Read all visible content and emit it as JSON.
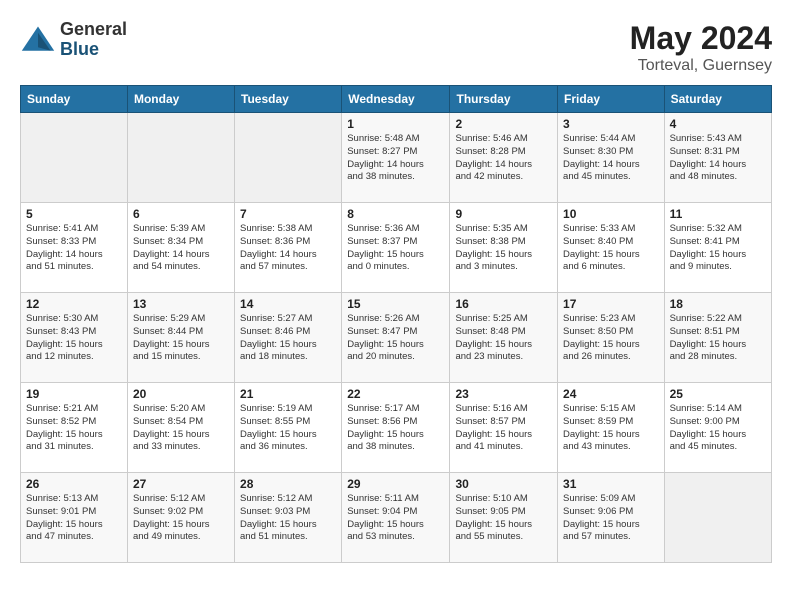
{
  "header": {
    "logo_general": "General",
    "logo_blue": "Blue",
    "month_year": "May 2024",
    "location": "Torteval, Guernsey"
  },
  "days_of_week": [
    "Sunday",
    "Monday",
    "Tuesday",
    "Wednesday",
    "Thursday",
    "Friday",
    "Saturday"
  ],
  "weeks": [
    [
      {
        "day": "",
        "info": ""
      },
      {
        "day": "",
        "info": ""
      },
      {
        "day": "",
        "info": ""
      },
      {
        "day": "1",
        "info": "Sunrise: 5:48 AM\nSunset: 8:27 PM\nDaylight: 14 hours\nand 38 minutes."
      },
      {
        "day": "2",
        "info": "Sunrise: 5:46 AM\nSunset: 8:28 PM\nDaylight: 14 hours\nand 42 minutes."
      },
      {
        "day": "3",
        "info": "Sunrise: 5:44 AM\nSunset: 8:30 PM\nDaylight: 14 hours\nand 45 minutes."
      },
      {
        "day": "4",
        "info": "Sunrise: 5:43 AM\nSunset: 8:31 PM\nDaylight: 14 hours\nand 48 minutes."
      }
    ],
    [
      {
        "day": "5",
        "info": "Sunrise: 5:41 AM\nSunset: 8:33 PM\nDaylight: 14 hours\nand 51 minutes."
      },
      {
        "day": "6",
        "info": "Sunrise: 5:39 AM\nSunset: 8:34 PM\nDaylight: 14 hours\nand 54 minutes."
      },
      {
        "day": "7",
        "info": "Sunrise: 5:38 AM\nSunset: 8:36 PM\nDaylight: 14 hours\nand 57 minutes."
      },
      {
        "day": "8",
        "info": "Sunrise: 5:36 AM\nSunset: 8:37 PM\nDaylight: 15 hours\nand 0 minutes."
      },
      {
        "day": "9",
        "info": "Sunrise: 5:35 AM\nSunset: 8:38 PM\nDaylight: 15 hours\nand 3 minutes."
      },
      {
        "day": "10",
        "info": "Sunrise: 5:33 AM\nSunset: 8:40 PM\nDaylight: 15 hours\nand 6 minutes."
      },
      {
        "day": "11",
        "info": "Sunrise: 5:32 AM\nSunset: 8:41 PM\nDaylight: 15 hours\nand 9 minutes."
      }
    ],
    [
      {
        "day": "12",
        "info": "Sunrise: 5:30 AM\nSunset: 8:43 PM\nDaylight: 15 hours\nand 12 minutes."
      },
      {
        "day": "13",
        "info": "Sunrise: 5:29 AM\nSunset: 8:44 PM\nDaylight: 15 hours\nand 15 minutes."
      },
      {
        "day": "14",
        "info": "Sunrise: 5:27 AM\nSunset: 8:46 PM\nDaylight: 15 hours\nand 18 minutes."
      },
      {
        "day": "15",
        "info": "Sunrise: 5:26 AM\nSunset: 8:47 PM\nDaylight: 15 hours\nand 20 minutes."
      },
      {
        "day": "16",
        "info": "Sunrise: 5:25 AM\nSunset: 8:48 PM\nDaylight: 15 hours\nand 23 minutes."
      },
      {
        "day": "17",
        "info": "Sunrise: 5:23 AM\nSunset: 8:50 PM\nDaylight: 15 hours\nand 26 minutes."
      },
      {
        "day": "18",
        "info": "Sunrise: 5:22 AM\nSunset: 8:51 PM\nDaylight: 15 hours\nand 28 minutes."
      }
    ],
    [
      {
        "day": "19",
        "info": "Sunrise: 5:21 AM\nSunset: 8:52 PM\nDaylight: 15 hours\nand 31 minutes."
      },
      {
        "day": "20",
        "info": "Sunrise: 5:20 AM\nSunset: 8:54 PM\nDaylight: 15 hours\nand 33 minutes."
      },
      {
        "day": "21",
        "info": "Sunrise: 5:19 AM\nSunset: 8:55 PM\nDaylight: 15 hours\nand 36 minutes."
      },
      {
        "day": "22",
        "info": "Sunrise: 5:17 AM\nSunset: 8:56 PM\nDaylight: 15 hours\nand 38 minutes."
      },
      {
        "day": "23",
        "info": "Sunrise: 5:16 AM\nSunset: 8:57 PM\nDaylight: 15 hours\nand 41 minutes."
      },
      {
        "day": "24",
        "info": "Sunrise: 5:15 AM\nSunset: 8:59 PM\nDaylight: 15 hours\nand 43 minutes."
      },
      {
        "day": "25",
        "info": "Sunrise: 5:14 AM\nSunset: 9:00 PM\nDaylight: 15 hours\nand 45 minutes."
      }
    ],
    [
      {
        "day": "26",
        "info": "Sunrise: 5:13 AM\nSunset: 9:01 PM\nDaylight: 15 hours\nand 47 minutes."
      },
      {
        "day": "27",
        "info": "Sunrise: 5:12 AM\nSunset: 9:02 PM\nDaylight: 15 hours\nand 49 minutes."
      },
      {
        "day": "28",
        "info": "Sunrise: 5:12 AM\nSunset: 9:03 PM\nDaylight: 15 hours\nand 51 minutes."
      },
      {
        "day": "29",
        "info": "Sunrise: 5:11 AM\nSunset: 9:04 PM\nDaylight: 15 hours\nand 53 minutes."
      },
      {
        "day": "30",
        "info": "Sunrise: 5:10 AM\nSunset: 9:05 PM\nDaylight: 15 hours\nand 55 minutes."
      },
      {
        "day": "31",
        "info": "Sunrise: 5:09 AM\nSunset: 9:06 PM\nDaylight: 15 hours\nand 57 minutes."
      },
      {
        "day": "",
        "info": ""
      }
    ]
  ]
}
